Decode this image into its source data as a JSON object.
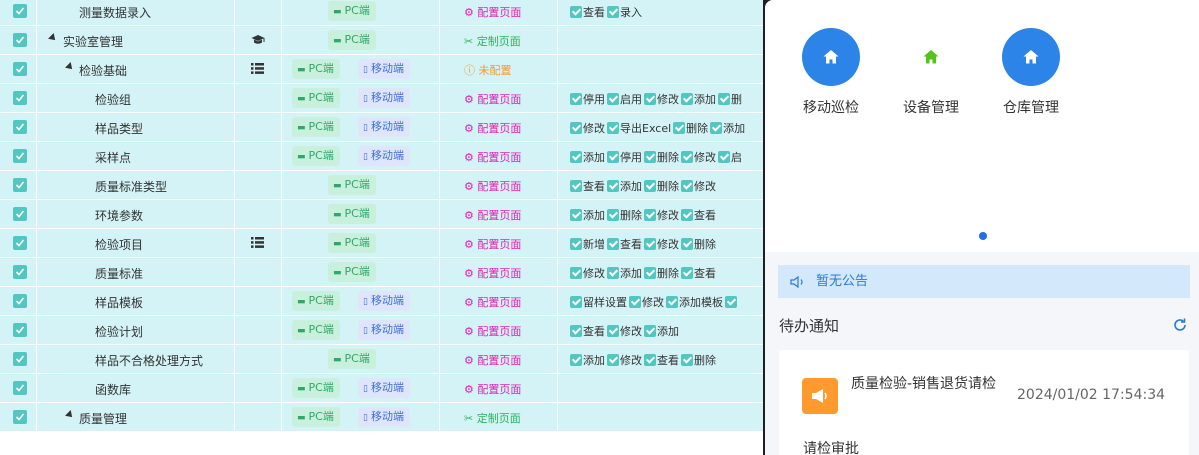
{
  "pc_label": "PC端",
  "mobile_label": "移动端",
  "rows": [
    {
      "name": "测量数据录入",
      "level": 1,
      "caret": false,
      "icon": "",
      "pc": true,
      "mobile": false,
      "config": {
        "text": "配置页面",
        "kind": "pink"
      },
      "perms": [
        "查看",
        "录入"
      ]
    },
    {
      "name": "实验室管理",
      "level": 1,
      "caret": true,
      "icon": "graduation-cap-icon",
      "pc": true,
      "mobile": false,
      "config": {
        "text": "定制页面",
        "kind": "green"
      },
      "perms": []
    },
    {
      "name": "检验基础",
      "level": 2,
      "caret": true,
      "icon": "list-icon",
      "pc": true,
      "mobile": true,
      "config": {
        "text": "未配置",
        "kind": "orange"
      },
      "perms": []
    },
    {
      "name": "检验组",
      "level": 3,
      "caret": false,
      "icon": "",
      "pc": true,
      "mobile": true,
      "config": {
        "text": "配置页面",
        "kind": "pink"
      },
      "perms": [
        "停用",
        "启用",
        "修改",
        "添加",
        "删"
      ]
    },
    {
      "name": "样品类型",
      "level": 3,
      "caret": false,
      "icon": "",
      "pc": true,
      "mobile": true,
      "config": {
        "text": "配置页面",
        "kind": "pink"
      },
      "perms": [
        "修改",
        "导出Excel",
        "删除",
        "添加"
      ]
    },
    {
      "name": "采样点",
      "level": 3,
      "caret": false,
      "icon": "",
      "pc": true,
      "mobile": true,
      "config": {
        "text": "配置页面",
        "kind": "pink"
      },
      "perms": [
        "添加",
        "停用",
        "删除",
        "修改",
        "启"
      ]
    },
    {
      "name": "质量标准类型",
      "level": 3,
      "caret": false,
      "icon": "",
      "pc": true,
      "mobile": false,
      "config": {
        "text": "配置页面",
        "kind": "pink"
      },
      "perms": [
        "查看",
        "添加",
        "删除",
        "修改"
      ]
    },
    {
      "name": "环境参数",
      "level": 3,
      "caret": false,
      "icon": "",
      "pc": true,
      "mobile": false,
      "config": {
        "text": "配置页面",
        "kind": "pink"
      },
      "perms": [
        "添加",
        "删除",
        "修改",
        "查看"
      ]
    },
    {
      "name": "检验项目",
      "level": 3,
      "caret": false,
      "icon": "list-icon",
      "pc": true,
      "mobile": false,
      "config": {
        "text": "配置页面",
        "kind": "pink"
      },
      "perms": [
        "新增",
        "查看",
        "修改",
        "删除"
      ]
    },
    {
      "name": "质量标准",
      "level": 3,
      "caret": false,
      "icon": "",
      "pc": true,
      "mobile": false,
      "config": {
        "text": "配置页面",
        "kind": "pink"
      },
      "perms": [
        "修改",
        "添加",
        "删除",
        "查看"
      ]
    },
    {
      "name": "样品模板",
      "level": 3,
      "caret": false,
      "icon": "",
      "pc": true,
      "mobile": true,
      "config": {
        "text": "配置页面",
        "kind": "pink"
      },
      "perms": [
        "留样设置",
        "修改",
        "添加模板",
        ""
      ]
    },
    {
      "name": "检验计划",
      "level": 3,
      "caret": false,
      "icon": "",
      "pc": true,
      "mobile": true,
      "config": {
        "text": "配置页面",
        "kind": "pink"
      },
      "perms": [
        "查看",
        "修改",
        "添加"
      ]
    },
    {
      "name": "样品不合格处理方式",
      "level": 3,
      "caret": false,
      "icon": "",
      "pc": true,
      "mobile": false,
      "config": {
        "text": "配置页面",
        "kind": "pink"
      },
      "perms": [
        "添加",
        "修改",
        "查看",
        "删除"
      ]
    },
    {
      "name": "函数库",
      "level": 3,
      "caret": false,
      "icon": "",
      "pc": true,
      "mobile": true,
      "config": {
        "text": "配置页面",
        "kind": "pink"
      },
      "perms": []
    },
    {
      "name": "质量管理",
      "level": 2,
      "caret": true,
      "icon": "",
      "pc": true,
      "mobile": true,
      "config": {
        "text": "定制页面",
        "kind": "green"
      },
      "perms": []
    }
  ],
  "mobile": {
    "quick_items": [
      {
        "label": "移动巡检",
        "icon": "home-icon",
        "circle_color": "#2d84e8",
        "icon_color": "#ffffff"
      },
      {
        "label": "设备管理",
        "icon": "home-icon",
        "circle_color": "#ffffff",
        "icon_color": "#52c41a"
      },
      {
        "label": "仓库管理",
        "icon": "home-icon",
        "circle_color": "#2d84e8",
        "icon_color": "#ffffff"
      }
    ],
    "notice": "暂无公告",
    "todo_title": "待办通知",
    "card": {
      "title": "质量检验-销售退货请检",
      "time": "2024/01/02 17:54:34",
      "subtitle": "请检审批"
    }
  }
}
